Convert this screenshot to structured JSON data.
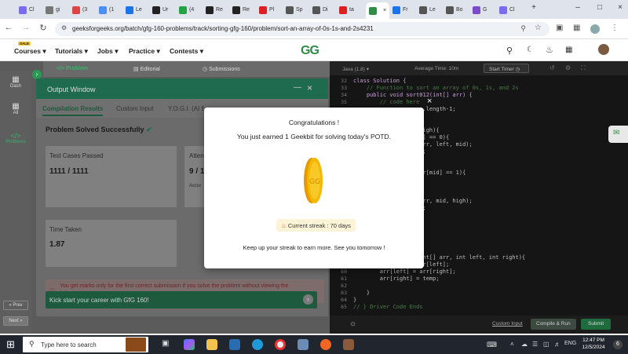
{
  "browser": {
    "tabs": [
      {
        "label": "Cl",
        "color": "#7a6cf0"
      },
      {
        "label": "gi",
        "color": "#777"
      },
      {
        "label": "(3",
        "color": "#d44"
      },
      {
        "label": "(1",
        "color": "#4b8ef5"
      },
      {
        "label": "Le",
        "color": "#1a73e8"
      },
      {
        "label": "Ur",
        "color": "#222"
      },
      {
        "label": "(4",
        "color": "#25a244"
      },
      {
        "label": "Re",
        "color": "#222"
      },
      {
        "label": "Re",
        "color": "#222"
      },
      {
        "label": "Pl",
        "color": "#e02020"
      },
      {
        "label": "Sp",
        "color": "#555"
      },
      {
        "label": "Di",
        "color": "#555"
      },
      {
        "label": "ta",
        "color": "#e02020"
      },
      {
        "label": "",
        "color": "#2f8d46"
      },
      {
        "label": "Fr",
        "color": "#1a73e8"
      },
      {
        "label": "Le",
        "color": "#555"
      },
      {
        "label": "Bo",
        "color": "#555"
      },
      {
        "label": "G",
        "color": "#7b4cc9"
      },
      {
        "label": "Cl",
        "color": "#7a6cf0"
      }
    ],
    "active_tab_close": "×",
    "new_tab": "+",
    "url": "geeksforgeeks.org/batch/gfg-160-problems/track/sorting-gfg-160/problem/sort-an-array-of-0s-1s-and-2s4231"
  },
  "site": {
    "sale_badge": "SALE",
    "menu": [
      "Courses",
      "Tutorials",
      "Jobs",
      "Practice",
      "Contests"
    ],
    "logo": "GG"
  },
  "problem_tabs": [
    "Problem",
    "Editorial",
    "Submissions"
  ],
  "sidebar": [
    "Dash",
    "All",
    "Problems"
  ],
  "sidebar_bottom": [
    "« Prev",
    "Next »"
  ],
  "output": {
    "title": "Output Window",
    "tabs": [
      "Compilation Results",
      "Custom Input",
      "Y.O.G.I. (AI Bo"
    ],
    "status": "Problem Solved Successfully",
    "test_cases_label": "Test Cases Passed",
    "test_cases_value": "1111 / 1111",
    "attempts_label": "Atten",
    "attempts_value": "9 / 1",
    "accuracy_label": "Accur",
    "time_label": "Time Taken",
    "time_value": "1.87",
    "notice": "You get marks only for the first correct submission if you solve the problem without viewing the full solution.",
    "banner": "Kick start your career with GfG 160!"
  },
  "editor": {
    "language": "Java (1.8)",
    "avg_time": "Average Time: 10m",
    "start_timer": "Start Timer",
    "lines": [
      {
        "n": "32",
        "t": "class Solution {"
      },
      {
        "n": "33",
        "t": "    // Function to sort an array of 0s, 1s, and 2s"
      },
      {
        "n": "34",
        "t": "    public void sort012(int[] arr) {"
      },
      {
        "n": "35",
        "t": "        // code here"
      },
      {
        "n": "",
        "t": "                     .length-1;"
      },
      {
        "n": "",
        "t": ""
      },
      {
        "n": "",
        "t": ""
      },
      {
        "n": "",
        "t": "                     igh){"
      },
      {
        "n": "",
        "t": "                     ] == 0){"
      },
      {
        "n": "",
        "t": "                     rr, left, mid);"
      },
      {
        "n": "",
        "t": "                     ;"
      },
      {
        "n": "",
        "t": ""
      },
      {
        "n": "",
        "t": ""
      },
      {
        "n": "",
        "t": "                     r[mid] == 1){"
      },
      {
        "n": "",
        "t": ""
      },
      {
        "n": "",
        "t": ""
      },
      {
        "n": "",
        "t": ""
      },
      {
        "n": "",
        "t": "                     rr, mid, high);"
      },
      {
        "n": "",
        "t": "                     ;"
      }
    ],
    "lower_lines": [
      {
        "n": "",
        "t": "                     nt[] arr, int left, int right){"
      },
      {
        "n": "59",
        "t": "        int temp = arr[left];"
      },
      {
        "n": "60",
        "t": "        arr[left] = arr[right];"
      },
      {
        "n": "61",
        "t": "        arr[right] = temp;"
      },
      {
        "n": "62",
        "t": ""
      },
      {
        "n": "63",
        "t": "    }"
      },
      {
        "n": "64",
        "t": "}"
      },
      {
        "n": "65",
        "t": "// } Driver Code Ends"
      }
    ],
    "custom_input": "Custom Input",
    "compile_run": "Compile & Run",
    "submit": "Submit"
  },
  "modal": {
    "close": "×",
    "title": "Congratulations !",
    "message": "You just earned 1 Geekbit for solving today's POTD.",
    "streak": "Current streak : 70 days",
    "footer": "Keep up your streak to earn more. See you tomorrow !"
  },
  "taskbar": {
    "search_placeholder": "Type here to search",
    "time": "12:47 PM",
    "date": "12/5/2024",
    "notification_count": "6"
  },
  "colors": {
    "brand_green": "#2f8d46",
    "coin": "#f5b800",
    "dark_header": "#1e6b50"
  }
}
